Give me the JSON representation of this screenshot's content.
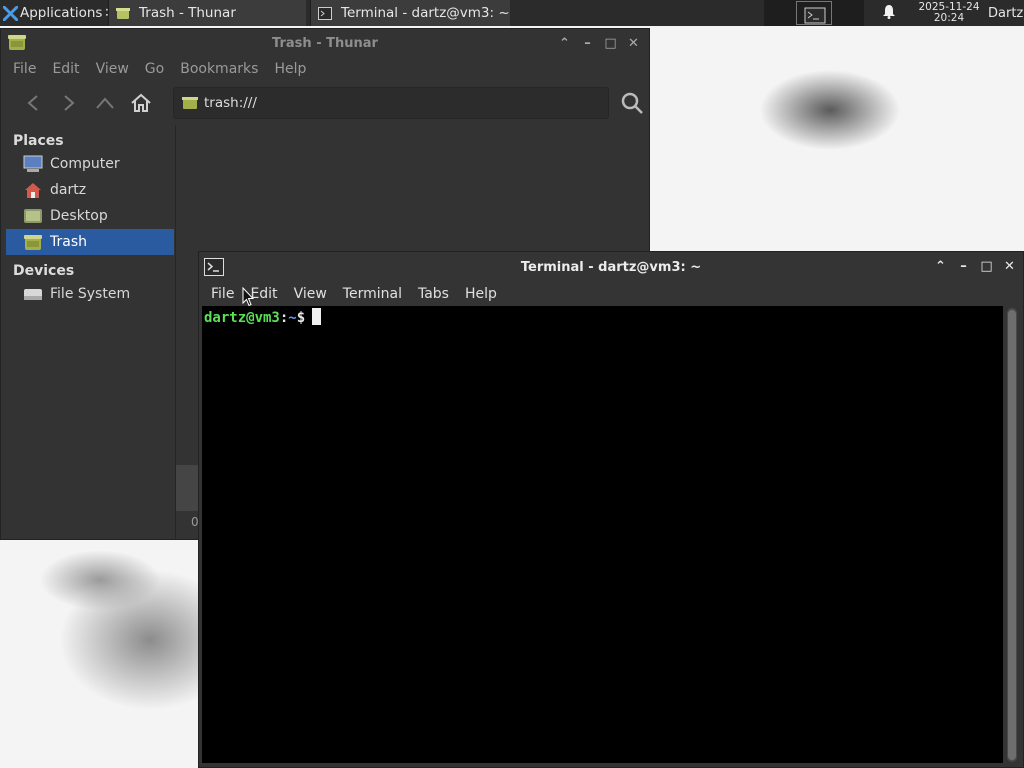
{
  "panel": {
    "applications_label": "Applications",
    "applications_trailing": "∷",
    "tasks": [
      {
        "label": "Trash - Thunar"
      },
      {
        "label": "Terminal - dartz@vm3: ~"
      }
    ],
    "clock_date": "2025-11-24",
    "clock_time": "20:24",
    "user": "Dartz"
  },
  "thunar": {
    "title": "Trash - Thunar",
    "menu": [
      "File",
      "Edit",
      "View",
      "Go",
      "Bookmarks",
      "Help"
    ],
    "location": "trash:///",
    "sidebar": {
      "places_header": "Places",
      "places": [
        "Computer",
        "dartz",
        "Desktop",
        "Trash"
      ],
      "selected": "Trash",
      "devices_header": "Devices",
      "devices": [
        "File System"
      ]
    },
    "status": "0"
  },
  "terminal": {
    "title": "Terminal - dartz@vm3: ~",
    "menu": [
      "File",
      "Edit",
      "View",
      "Terminal",
      "Tabs",
      "Help"
    ],
    "prompt_user": "dartz@vm3",
    "prompt_sep": ":",
    "prompt_path": "~",
    "prompt_symbol": "$"
  },
  "colors": {
    "panel_bg": "#2b2b2b",
    "window_bg": "#333333",
    "selection": "#2a5ba0",
    "prompt_green": "#5be055",
    "prompt_blue": "#5c9cf0"
  },
  "icons": [
    "xfce-logo-icon",
    "trash-icon",
    "terminal-icon",
    "workspace-icon",
    "bell-icon",
    "back-icon",
    "forward-icon",
    "up-icon",
    "home-icon",
    "search-icon",
    "computer-icon",
    "home-folder-icon",
    "desktop-icon",
    "drive-icon",
    "mouse-pointer-icon"
  ]
}
